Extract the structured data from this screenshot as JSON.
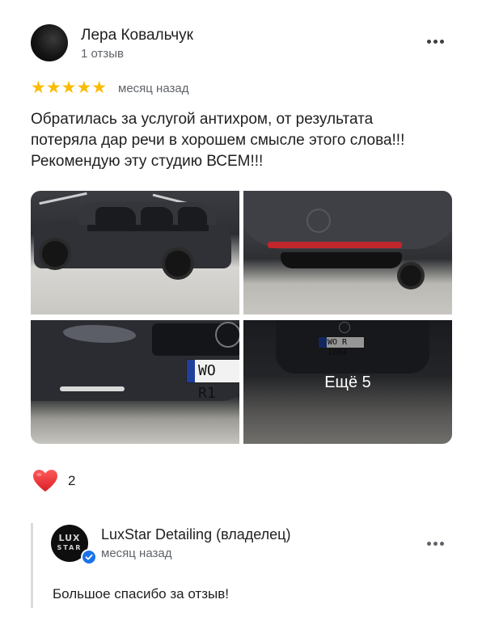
{
  "review": {
    "author_name": "Лера Ковальчук",
    "author_reviews": "1 отзыв",
    "rating": 5,
    "stars": "★★★★★",
    "time": "месяц назад",
    "text": "Обратилась  за услугой антихром,  от результата\nпотеряла дар речи в хорошем смысле этого слова!!!\nРекомендую эту студию ВСЕМ!!!",
    "photos": [
      {
        "name": "photo-car-side"
      },
      {
        "name": "photo-rear-bumper"
      },
      {
        "name": "photo-front-grille",
        "plate": "WO R1"
      },
      {
        "name": "photo-rear-plate",
        "plate": "WO R 1084",
        "overlay_label": "Ещё 5"
      }
    ]
  },
  "reactions": {
    "icon": "heart-icon",
    "count": "2"
  },
  "owner_reply": {
    "name": "LuxStar Detailing (владелец)",
    "time": "месяц назад",
    "text": "Большое спасибо за отзыв!",
    "logo_line1": "LUX",
    "logo_line2": "STAR",
    "verified_icon": "verified-badge-icon"
  },
  "colors": {
    "star": "#fbbc04",
    "verified": "#1a73e8",
    "heart": "#ea3a3a"
  }
}
